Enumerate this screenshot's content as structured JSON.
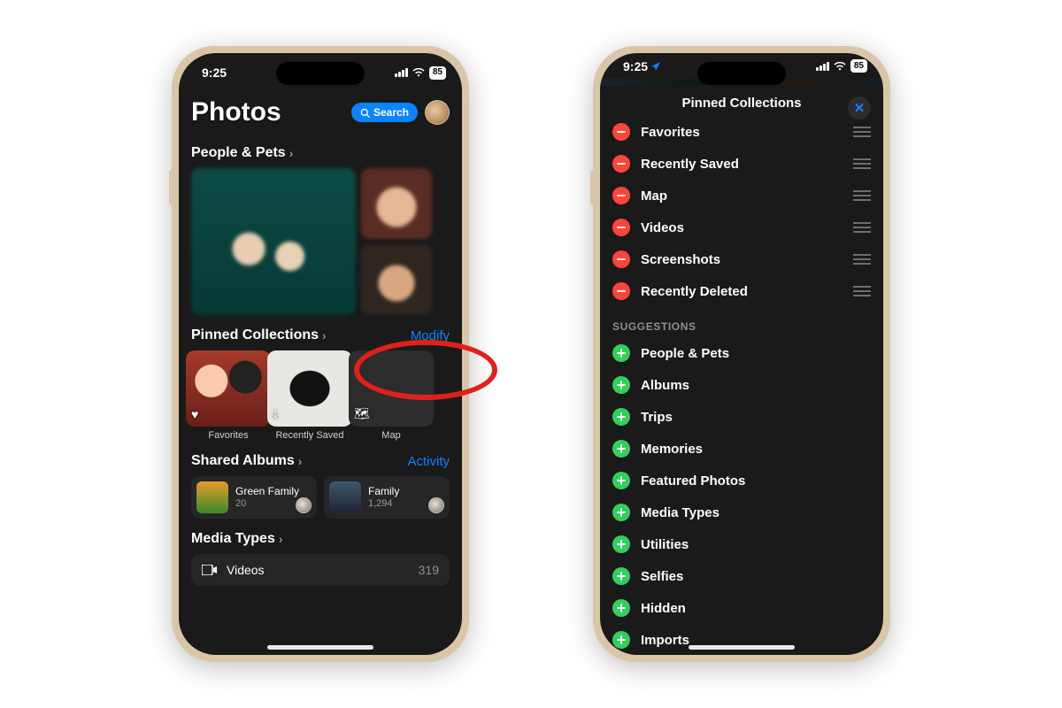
{
  "status": {
    "time": "9:25",
    "battery": "85"
  },
  "phoneA": {
    "title": "Photos",
    "search_label": "Search",
    "sections": {
      "people": {
        "label": "People & Pets"
      },
      "pinned": {
        "label": "Pinned Collections",
        "action": "Modify",
        "items": [
          {
            "label": "Favorites",
            "glyph": "♥",
            "style": "fav"
          },
          {
            "label": "Recently Saved",
            "glyph": "⤓",
            "style": "rsaved"
          },
          {
            "label": "Map",
            "glyph": "🗺",
            "style": ""
          }
        ]
      },
      "shared": {
        "label": "Shared Albums",
        "action": "Activity",
        "items": [
          {
            "name": "Green Family",
            "count": "20"
          },
          {
            "name": "Family",
            "count": "1,294"
          }
        ]
      },
      "media": {
        "label": "Media Types",
        "row": {
          "name": "Videos",
          "count": "319"
        }
      }
    }
  },
  "phoneB": {
    "title": "Pinned Collections",
    "pinned": [
      "Favorites",
      "Recently Saved",
      "Map",
      "Videos",
      "Screenshots",
      "Recently Deleted"
    ],
    "suggestions_label": "Suggestions",
    "suggestions": [
      "People & Pets",
      "Albums",
      "Trips",
      "Memories",
      "Featured Photos",
      "Media Types",
      "Utilities",
      "Selfies",
      "Hidden",
      "Imports"
    ]
  }
}
